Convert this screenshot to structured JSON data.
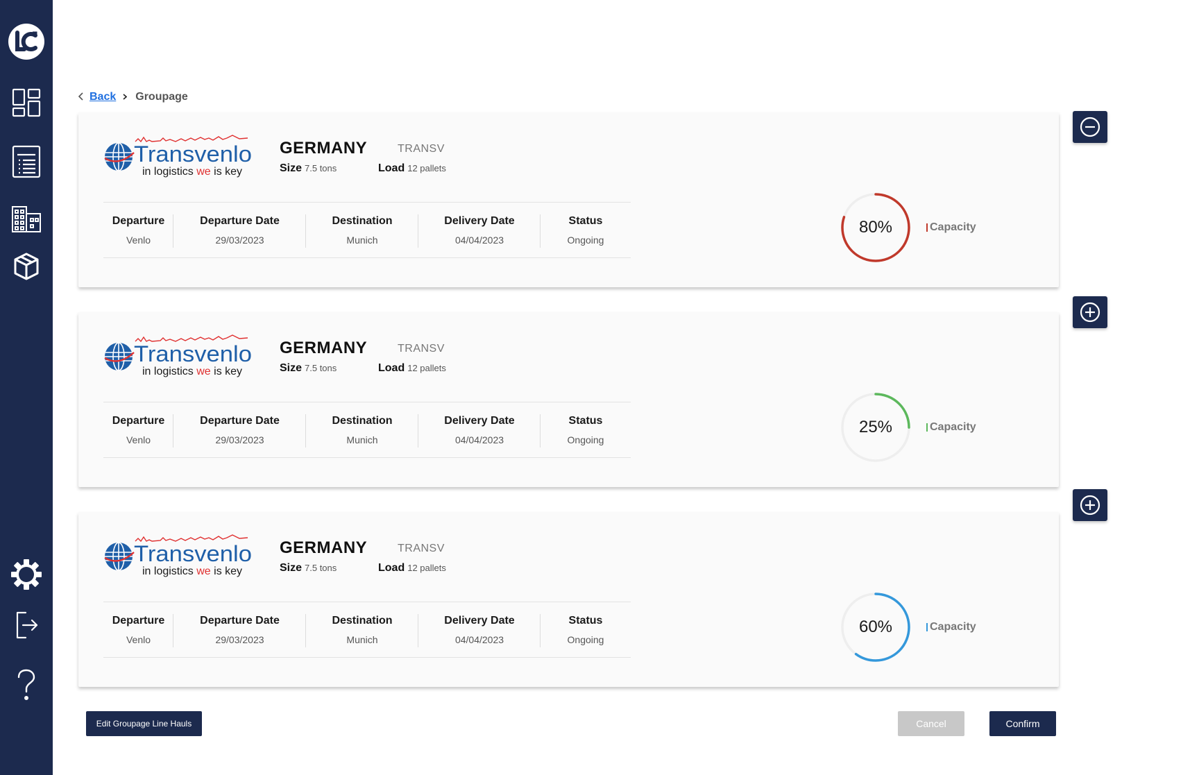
{
  "sidebar": {
    "logo_text": "LC",
    "items": [
      {
        "icon": "dashboard-icon"
      },
      {
        "icon": "list-icon"
      },
      {
        "icon": "building-icon"
      },
      {
        "icon": "package-icon"
      },
      {
        "icon": "gear-icon"
      },
      {
        "icon": "logout-icon"
      },
      {
        "icon": "help-icon"
      }
    ]
  },
  "breadcrumb": {
    "back_label": "Back",
    "current_label": "Groupage"
  },
  "cards": [
    {
      "logo_title": "Transvenlo",
      "logo_slogan_1": "in logistics ",
      "logo_slogan_we": "we",
      "logo_slogan_2": " is key",
      "country": "GERMANY",
      "carrier": "TRANSV",
      "size_label": "Size",
      "size_value": "7.5 tons",
      "load_label": "Load",
      "load_value": "12 pallets",
      "columns": [
        {
          "label": "Departure",
          "value": "Venlo"
        },
        {
          "label": "Departure Date",
          "value": "29/03/2023"
        },
        {
          "label": "Destination",
          "value": "Munich"
        },
        {
          "label": "Delivery Date",
          "value": "04/04/2023"
        },
        {
          "label": "Status",
          "value": "Ongoing"
        }
      ],
      "capacity": 0.8,
      "capacity_text": "80%",
      "capacity_label": "Capacity",
      "capacity_color": "#c0392b",
      "toggle_icon": "minus-circle-icon"
    },
    {
      "logo_title": "Transvenlo",
      "logo_slogan_1": "in logistics ",
      "logo_slogan_we": "we",
      "logo_slogan_2": " is key",
      "country": "GERMANY",
      "carrier": "TRANSV",
      "size_label": "Size",
      "size_value": "7.5 tons",
      "load_label": "Load",
      "load_value": "12 pallets",
      "columns": [
        {
          "label": "Departure",
          "value": "Venlo"
        },
        {
          "label": "Departure Date",
          "value": "29/03/2023"
        },
        {
          "label": "Destination",
          "value": "Munich"
        },
        {
          "label": "Delivery Date",
          "value": "04/04/2023"
        },
        {
          "label": "Status",
          "value": "Ongoing"
        }
      ],
      "capacity": 0.25,
      "capacity_text": "25%",
      "capacity_label": "Capacity",
      "capacity_color": "#5cb85c",
      "toggle_icon": "plus-circle-icon"
    },
    {
      "logo_title": "Transvenlo",
      "logo_slogan_1": "in logistics ",
      "logo_slogan_we": "we",
      "logo_slogan_2": " is key",
      "country": "GERMANY",
      "carrier": "TRANSV",
      "size_label": "Size",
      "size_value": "7.5 tons",
      "load_label": "Load",
      "load_value": "12 pallets",
      "columns": [
        {
          "label": "Departure",
          "value": "Venlo"
        },
        {
          "label": "Departure Date",
          "value": "29/03/2023"
        },
        {
          "label": "Destination",
          "value": "Munich"
        },
        {
          "label": "Delivery Date",
          "value": "04/04/2023"
        },
        {
          "label": "Status",
          "value": "Ongoing"
        }
      ],
      "capacity": 0.6,
      "capacity_text": "60%",
      "capacity_label": "Capacity",
      "capacity_color": "#3498db",
      "toggle_icon": "plus-circle-icon"
    }
  ],
  "footer": {
    "edit_label": "Edit Groupage Line Hauls",
    "cancel_label": "Cancel",
    "confirm_label": "Confirm"
  },
  "colors": {
    "sidebar_bg": "#1c2a4e",
    "link": "#1f6fe0",
    "logo_blue": "#1f5fa8",
    "logo_red": "#e03030"
  }
}
